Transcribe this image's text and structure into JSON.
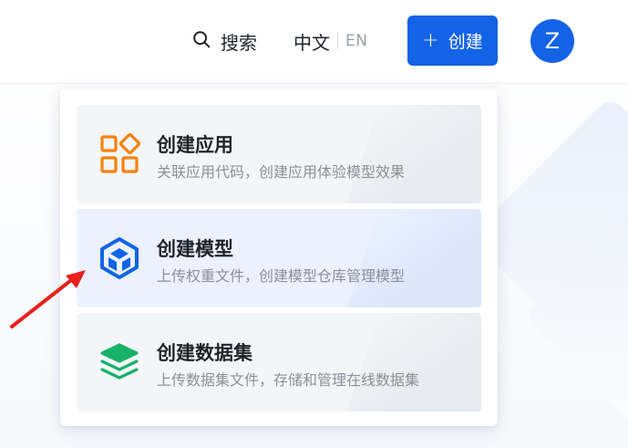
{
  "header": {
    "search_label": "搜索",
    "lang_zh": "中文",
    "lang_en": "EN",
    "create_label": "创建",
    "avatar_initial": "Z"
  },
  "dropdown": {
    "items": [
      {
        "title": "创建应用",
        "desc": "关联应用代码，创建应用体验模型效果",
        "icon": "app-grid-icon",
        "color": "#f5820b"
      },
      {
        "title": "创建模型",
        "desc": "上传权重文件，创建模型仓库管理模型",
        "icon": "model-cube-icon",
        "color": "#1363e6"
      },
      {
        "title": "创建数据集",
        "desc": "上传数据集文件，存储和管理在线数据集",
        "icon": "dataset-layers-icon",
        "color": "#17b26a"
      }
    ]
  },
  "colors": {
    "primary": "#1363e6",
    "app_orange": "#f5820b",
    "dataset_green": "#17b26a",
    "arrow_red": "#e8211d"
  }
}
